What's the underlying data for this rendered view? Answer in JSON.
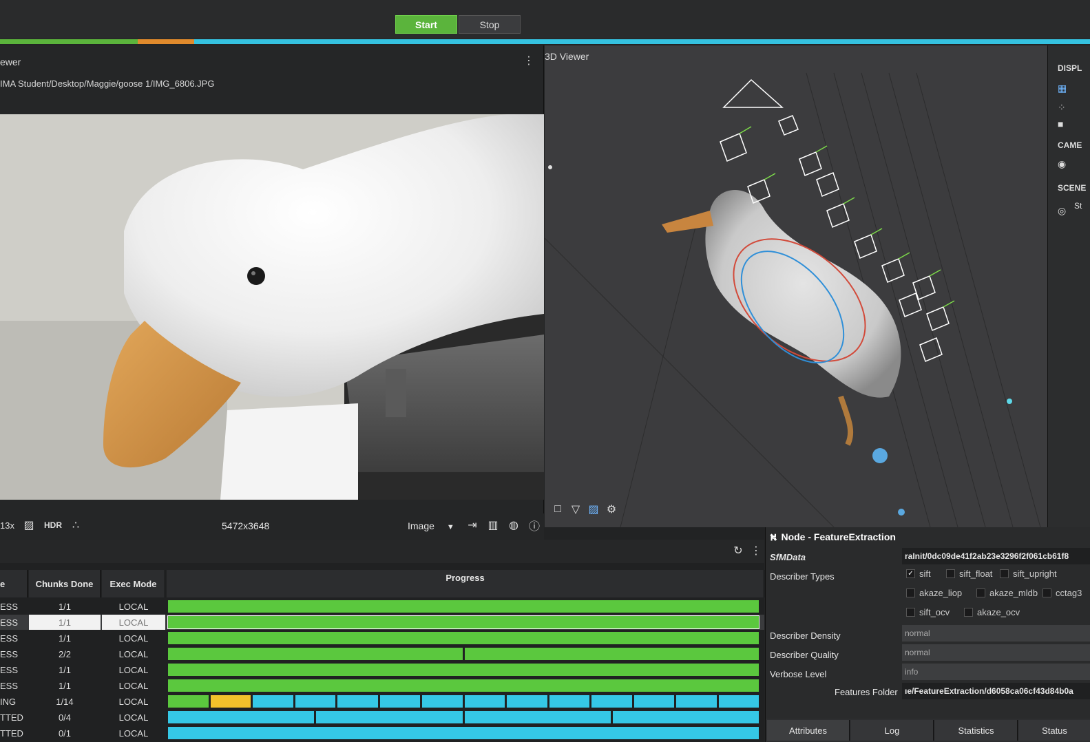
{
  "toolbar": {
    "start_label": "Start",
    "stop_label": "Stop"
  },
  "image_viewer": {
    "title": "ewer",
    "path": "IMA Student/Desktop/Maggie/goose 1/IMG_6806.JPG",
    "zoom": "13x",
    "hdr_label": "HDR",
    "resolution": "5472x3648",
    "display_mode": "Image"
  },
  "viewer3d": {
    "title": "3D Viewer"
  },
  "side_panel": {
    "display_label": "DISPL",
    "camera_label": "CAME",
    "scene_label": "SCENE",
    "scene_item": "St"
  },
  "task_manager": {
    "headers": {
      "status": "e",
      "chunks": "Chunks Done",
      "exec": "Exec Mode",
      "progress": "Progress"
    },
    "rows": [
      {
        "status": "ESS",
        "chunks": "1/1",
        "exec": "LOCAL",
        "selected": false,
        "segments": [
          {
            "w": 1,
            "c": "#5bc83e"
          }
        ]
      },
      {
        "status": "ESS",
        "chunks": "1/1",
        "exec": "LOCAL",
        "selected": true,
        "segments": [
          {
            "w": 1,
            "c": "#5bc83e"
          }
        ]
      },
      {
        "status": "ESS",
        "chunks": "1/1",
        "exec": "LOCAL",
        "selected": false,
        "segments": [
          {
            "w": 1,
            "c": "#5bc83e"
          }
        ]
      },
      {
        "status": "ESS",
        "chunks": "2/2",
        "exec": "LOCAL",
        "selected": false,
        "segments": [
          {
            "w": 1,
            "c": "#5bc83e"
          },
          {
            "w": 1,
            "c": "#5bc83e"
          }
        ]
      },
      {
        "status": "ESS",
        "chunks": "1/1",
        "exec": "LOCAL",
        "selected": false,
        "segments": [
          {
            "w": 1,
            "c": "#5bc83e"
          }
        ]
      },
      {
        "status": "ESS",
        "chunks": "1/1",
        "exec": "LOCAL",
        "selected": false,
        "segments": [
          {
            "w": 1,
            "c": "#5bc83e"
          }
        ]
      },
      {
        "status": "ING",
        "chunks": "1/14",
        "exec": "LOCAL",
        "selected": false,
        "segments": [
          {
            "w": 1,
            "c": "#5bc83e"
          },
          {
            "w": 1,
            "c": "#f3c12b"
          },
          {
            "w": 1,
            "c": "#35c8e6"
          },
          {
            "w": 1,
            "c": "#35c8e6"
          },
          {
            "w": 1,
            "c": "#35c8e6"
          },
          {
            "w": 1,
            "c": "#35c8e6"
          },
          {
            "w": 1,
            "c": "#35c8e6"
          },
          {
            "w": 1,
            "c": "#35c8e6"
          },
          {
            "w": 1,
            "c": "#35c8e6"
          },
          {
            "w": 1,
            "c": "#35c8e6"
          },
          {
            "w": 1,
            "c": "#35c8e6"
          },
          {
            "w": 1,
            "c": "#35c8e6"
          },
          {
            "w": 1,
            "c": "#35c8e6"
          },
          {
            "w": 1,
            "c": "#35c8e6"
          }
        ]
      },
      {
        "status": "TTED",
        "chunks": "0/4",
        "exec": "LOCAL",
        "selected": false,
        "segments": [
          {
            "w": 1,
            "c": "#35c8e6"
          },
          {
            "w": 1,
            "c": "#35c8e6"
          },
          {
            "w": 1,
            "c": "#35c8e6"
          },
          {
            "w": 1,
            "c": "#35c8e6"
          }
        ]
      },
      {
        "status": "TTED",
        "chunks": "0/1",
        "exec": "LOCAL",
        "selected": false,
        "segments": [
          {
            "w": 1,
            "c": "#35c8e6"
          }
        ]
      }
    ]
  },
  "attribute_editor": {
    "title": "Node - FeatureExtraction",
    "sfm_label": "SfMData",
    "sfm_value": "raInit/0dc09de41f2ab23e3296f2f061cb61f8",
    "describer_types_label": "Describer Types",
    "describers": [
      {
        "name": "sift",
        "checked": true
      },
      {
        "name": "sift_float",
        "checked": false
      },
      {
        "name": "sift_upright",
        "checked": false
      },
      {
        "name": "akaze_liop",
        "checked": false
      },
      {
        "name": "akaze_mldb",
        "checked": false
      },
      {
        "name": "cctag3",
        "checked": false
      },
      {
        "name": "sift_ocv",
        "checked": false
      },
      {
        "name": "akaze_ocv",
        "checked": false
      }
    ],
    "density_label": "Describer Density",
    "density_value": "normal",
    "quality_label": "Describer Quality",
    "quality_value": "normal",
    "verbose_label": "Verbose Level",
    "verbose_value": "info",
    "features_label": "Features Folder",
    "features_value": "ıe/FeatureExtraction/d6058ca06cf43d84b0a",
    "tabs": [
      "Attributes",
      "Log",
      "Statistics",
      "Status"
    ]
  }
}
